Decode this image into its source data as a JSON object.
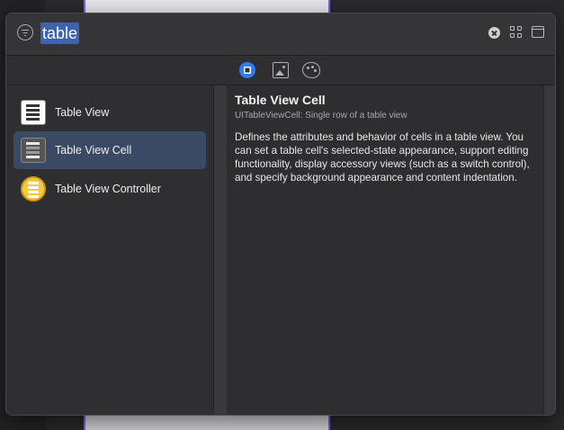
{
  "search": {
    "query": "table"
  },
  "header_icons": [
    "filter-icon",
    "clear-search-icon",
    "grid-view-icon",
    "window-icon"
  ],
  "tabs": [
    {
      "name": "objects",
      "icon": "objects-icon",
      "selected": true
    },
    {
      "name": "media",
      "icon": "image-icon",
      "selected": false
    },
    {
      "name": "colors",
      "icon": "palette-icon",
      "selected": false
    }
  ],
  "items": [
    {
      "label": "Table View",
      "icon": "table-view-icon",
      "selected": false
    },
    {
      "label": "Table View Cell",
      "icon": "table-view-cell-icon",
      "selected": true
    },
    {
      "label": "Table View Controller",
      "icon": "table-view-controller-icon",
      "selected": false
    }
  ],
  "detail": {
    "title": "Table View Cell",
    "subtitle": "UITableViewCell: Single row of a table view",
    "description": "Defines the attributes and behavior of cells in a table view. You can set a table cell's selected-state appearance, support editing functionality, display accessory views (such as a switch control), and specify background appearance and content indentation."
  },
  "colors": {
    "accent": "#2f7cf6",
    "selection": "#3b4a64",
    "search_highlight": "#3d63b0"
  }
}
